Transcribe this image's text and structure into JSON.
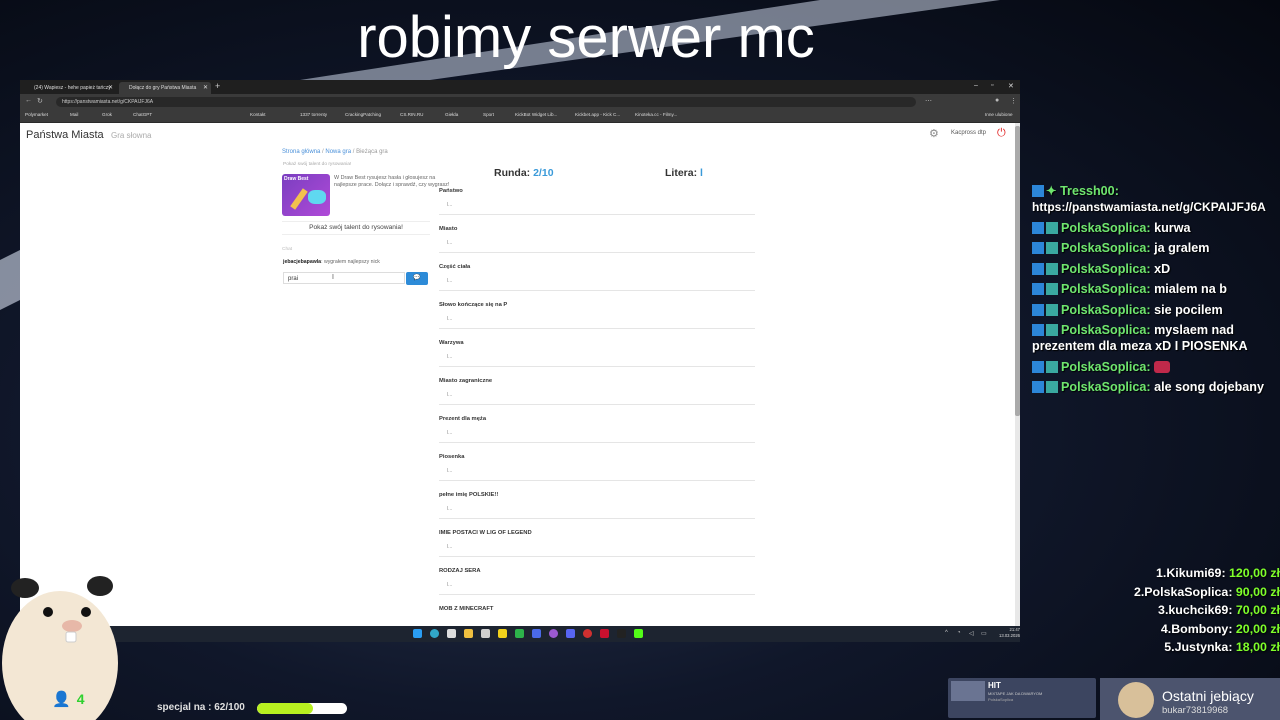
{
  "stream": {
    "title": "robimy serwer mc"
  },
  "browser": {
    "tabs": [
      {
        "label": "(24) Wapiesz - hehe papież tańczy"
      },
      {
        "label": "Dołącz do gry Państwa Miasta"
      }
    ],
    "address": "https://panstwamiasta.net/g/CKPAIJFJ6A",
    "bookmarks": [
      "Polymarket",
      "Mail",
      "Grok",
      "ChatGPT",
      "Kontakt",
      "1337 torrenty",
      "CrackingPatching",
      "CS.RIN.RU",
      "Giełda",
      "Sport",
      "KickBot Widget Lib...",
      "Kickbet.app - Kick C...",
      "Kinoteka.cc - Filmy...",
      "Inne ulubione"
    ]
  },
  "site": {
    "title": "Państwa Miasta",
    "subtitle": "Gra słowna",
    "user": "Kacpross dtp"
  },
  "breadcrumb": {
    "home": "Strona główna",
    "new_game": "Nowa gra",
    "current": "Bieżąca gra"
  },
  "draw_promo": {
    "heading": "Pokaż swój talent do rysowania!",
    "img_label": "Draw Best",
    "text": "W Draw Best rysujesz hasła i głosujesz na najlepsze prace. Dołącz i sprawdź, czy wygrasz!",
    "button": "Pokaż swój talent do rysowania!"
  },
  "chat": {
    "label": "Chat",
    "author": "jebacjebapawla",
    "message": "wygrałem najlepszy nick",
    "input_value": "prai",
    "send_icon": "chat-bubble-icon"
  },
  "game": {
    "round_label": "Runda:",
    "round_value": "2/10",
    "letter_label": "Litera:",
    "letter_value": "l",
    "fields": [
      {
        "label": "Państwo",
        "value": "l..."
      },
      {
        "label": "Miasto",
        "value": "l..."
      },
      {
        "label": "Część ciała",
        "value": "l..."
      },
      {
        "label": "Słowo kończące się na P",
        "value": "l..."
      },
      {
        "label": "Warzywa",
        "value": "l..."
      },
      {
        "label": "Miasto zagraniczne",
        "value": "l..."
      },
      {
        "label": "Prezent dla męża",
        "value": "l..."
      },
      {
        "label": "Piosenka",
        "value": "l..."
      },
      {
        "label": "pełne imię POLSKIE!!",
        "value": "l..."
      },
      {
        "label": "IMIE POSTACI W LIG OF LEGEND",
        "value": "l..."
      },
      {
        "label": "RODZAJ SERA",
        "value": "l..."
      },
      {
        "label": "MOB Z MINECRAFT",
        "value": ""
      }
    ]
  },
  "taskbar": {
    "time": "21:47",
    "date": "13.03.2026"
  },
  "stream_chat": [
    {
      "user": "Tressh00",
      "sep": ":",
      "text": "https://panstwamiasta.net/g/CKPAIJFJ6A"
    },
    {
      "user": "PolskaSoplica",
      "sep": ": ",
      "text": "kurwa"
    },
    {
      "user": "PolskaSoplica",
      "sep": ": ",
      "text": "ja gralem"
    },
    {
      "user": "PolskaSoplica",
      "sep": ": ",
      "text": "xD"
    },
    {
      "user": "PolskaSoplica",
      "sep": ": ",
      "text": "mialem na b"
    },
    {
      "user": "PolskaSoplica",
      "sep": ": ",
      "text": "sie pocilem"
    },
    {
      "user": "PolskaSoplica",
      "sep": ": ",
      "text": "myslaem nad prezentem dla meza xD I PIOSENKA"
    },
    {
      "user": "PolskaSoplica",
      "sep": ": ",
      "text": ""
    },
    {
      "user": "PolskaSoplica",
      "sep": ": ",
      "text": "ale song dojebany"
    }
  ],
  "leaderboard": [
    {
      "rank": "1.",
      "name": "Kikumi69",
      "amount": "120,00 zł"
    },
    {
      "rank": "2.",
      "name": "PolskaSoplica",
      "amount": "90,00 zł"
    },
    {
      "rank": "3.",
      "name": "kuchcik69",
      "amount": "70,00 zł"
    },
    {
      "rank": "4.",
      "name": "Bombony",
      "amount": "20,00 zł"
    },
    {
      "rank": "5.",
      "name": "Justynka",
      "amount": "18,00 zł"
    }
  ],
  "viewers": {
    "count": "4"
  },
  "goal": {
    "text": "specjal na : 62/100",
    "progress": 0.62
  },
  "now_playing": {
    "logo": "HIT",
    "title": "MIXTAPE JAK DA DWARYOM",
    "artist": "PolskaSoplica"
  },
  "last_sub": {
    "label": "Ostatni jebiący",
    "user": "bukar73819968"
  },
  "colors": {
    "accent": "#3a9ad9",
    "chat_user": "#6fe66f",
    "money": "#7fff2a",
    "goal_fill": "#b8f020",
    "power": "#e02020"
  }
}
